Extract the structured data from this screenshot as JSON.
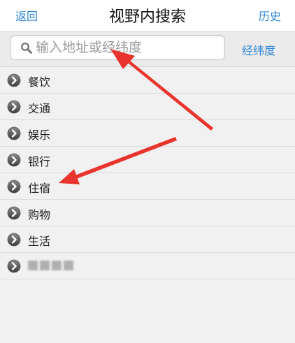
{
  "navbar": {
    "back_label": "返回",
    "title": "视野内搜索",
    "history_label": "历史"
  },
  "search": {
    "placeholder": "输入地址或经纬度",
    "value": "",
    "latlng_label": "经纬度"
  },
  "categories": [
    {
      "label": "餐饮"
    },
    {
      "label": "交通"
    },
    {
      "label": "娱乐"
    },
    {
      "label": "银行"
    },
    {
      "label": "住宿"
    },
    {
      "label": "购物"
    },
    {
      "label": "生活"
    },
    {
      "label": ""
    }
  ],
  "colors": {
    "accent": "#2c86d9",
    "annotation_arrow": "#e8342c"
  },
  "icons": {
    "search": "search-icon",
    "disclosure": "chevron-right-circle-icon"
  }
}
